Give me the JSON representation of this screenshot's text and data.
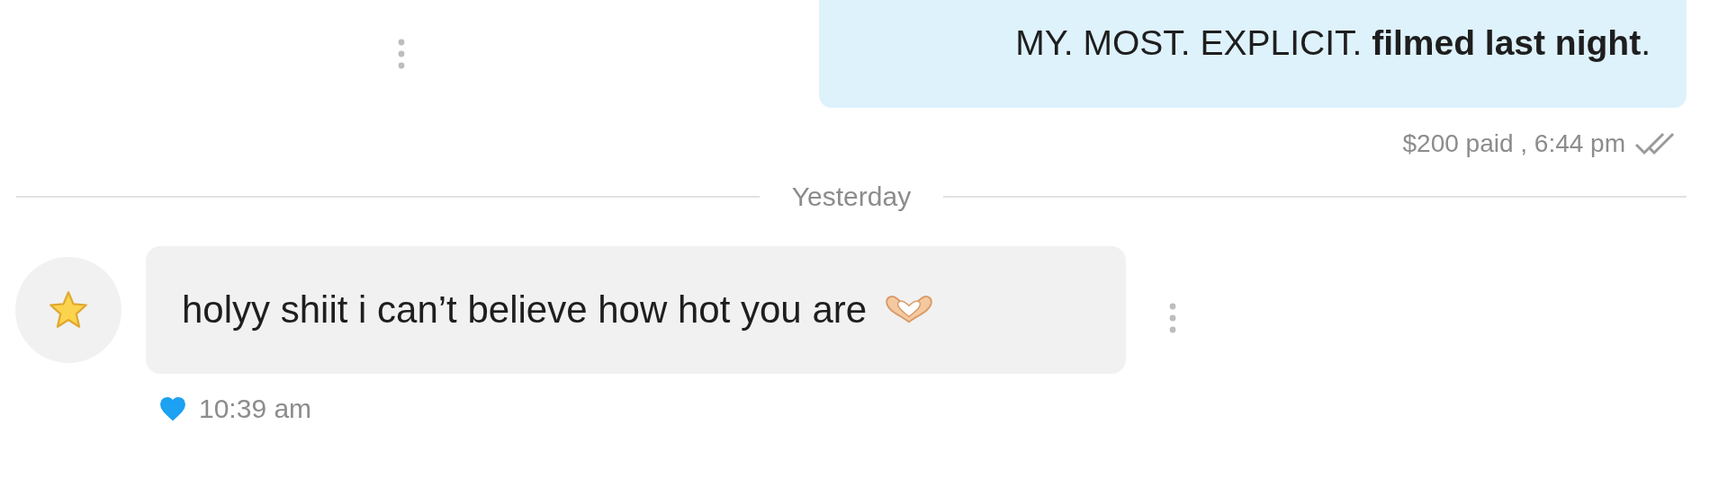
{
  "outgoing_message": {
    "text": "MY. MOST. EXPLICIT. **filmed last night**.",
    "meta": "$200 paid , 6:44 pm",
    "read": true
  },
  "date_divider": "Yesterday",
  "incoming_message": {
    "text": "holyy shiit i can’t believe how hot you are",
    "time": "10:39 am",
    "liked": true
  }
}
